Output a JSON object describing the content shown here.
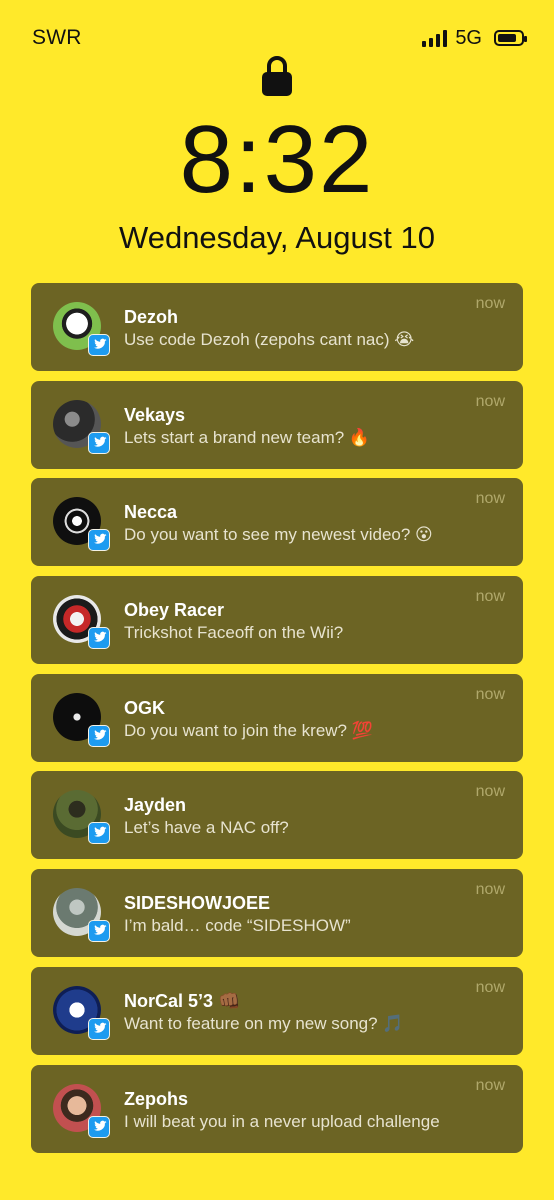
{
  "status_bar": {
    "carrier": "SWR",
    "network": "5G",
    "battery_level": 0.8
  },
  "lock_screen": {
    "time": "8:32",
    "date": "Wednesday, August 10"
  },
  "notifications": [
    {
      "name": "Dezoh",
      "message": "Use code Dezoh (zepohs cant nac) 😭",
      "time": "now",
      "app": "twitter-icon"
    },
    {
      "name": "Vekays",
      "message": "Lets start a brand new team? 🔥",
      "time": "now",
      "app": "twitter-icon"
    },
    {
      "name": "Necca",
      "message": "Do you want to see my newest video? 😮",
      "time": "now",
      "app": "twitter-icon"
    },
    {
      "name": "Obey Racer",
      "message": "Trickshot Faceoff on the Wii?",
      "time": "now",
      "app": "twitter-icon"
    },
    {
      "name": "OGK",
      "message": "Do you want to join the krew? 💯",
      "time": "now",
      "app": "twitter-icon"
    },
    {
      "name": "Jayden",
      "message": "Let’s have a NAC off?",
      "time": "now",
      "app": "twitter-icon"
    },
    {
      "name": "SIDESHOWJOEE",
      "message": "I’m bald… code “SIDESHOW”",
      "time": "now",
      "app": "twitter-icon"
    },
    {
      "name": "NorCal 5’3 👊🏾",
      "message": "Want to feature on my new song? 🎵",
      "time": "now",
      "app": "twitter-icon"
    },
    {
      "name": "Zepohs",
      "message": "I will beat you in a never upload challenge",
      "time": "now",
      "app": "twitter-icon"
    }
  ],
  "colors": {
    "background": "#ffe92a",
    "notification_bg": "#6c6424",
    "twitter_blue": "#1d9bf0"
  }
}
